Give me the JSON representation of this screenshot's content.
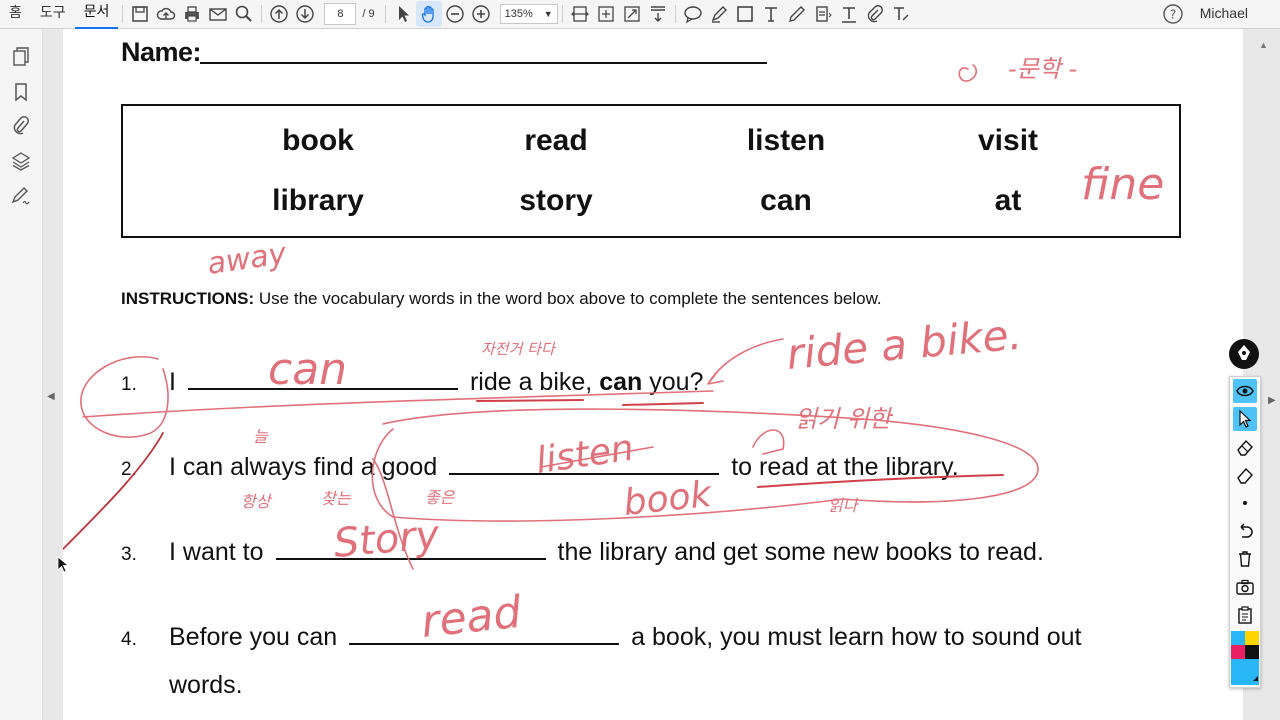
{
  "toolbar": {
    "tabs": [
      "홈",
      "도구",
      "문서"
    ],
    "active_tab": "문서",
    "current_page": "8",
    "total_pages": "/ 9",
    "zoom": "135%",
    "user": "Michael"
  },
  "document": {
    "name_label": "Name:",
    "word_box": [
      "book",
      "read",
      "listen",
      "visit",
      "library",
      "story",
      "can",
      "at"
    ],
    "instructions_bold": "INSTRUCTIONS:",
    "instructions_text": " Use the vocabulary words in the word box above to complete the sentences below.",
    "questions": [
      {
        "num": "1.",
        "before": "I",
        "after_1": "ride a bike, ",
        "after_bold": "can",
        "after_2": " you?"
      },
      {
        "num": "2.",
        "before": "I can always find a good",
        "after_1": "to read at the library."
      },
      {
        "num": "3.",
        "before": "I want to",
        "after_1": "the library and get some new books to read."
      },
      {
        "num": "4.",
        "before": "Before you can",
        "after_1": "a book, you must learn how to sound out",
        "line2": "words."
      }
    ]
  },
  "handwriting": {
    "top_right_korean": "-문학 -",
    "fine": "fine",
    "away": "away",
    "q1_can": "can",
    "q1_korean": "자전거 타다",
    "q1_ride": "ride a bike.",
    "q2_listen": "listen",
    "q2_book": "book",
    "q2_korean_above": "읽기 위한",
    "q2_korean_below": "읽다",
    "q2_korean_left_1": "늘",
    "q2_korean_left_2": "찾는",
    "q2_korean_left_3": "항상",
    "q2_korean_left_4": "좋은",
    "q3_story": "Story",
    "q4_read": "read"
  },
  "colors": {
    "ink": "#e0707a",
    "ink_dark": "#d0404a",
    "accent": "#1473e6",
    "palette_selected": "#4fc3f7"
  }
}
